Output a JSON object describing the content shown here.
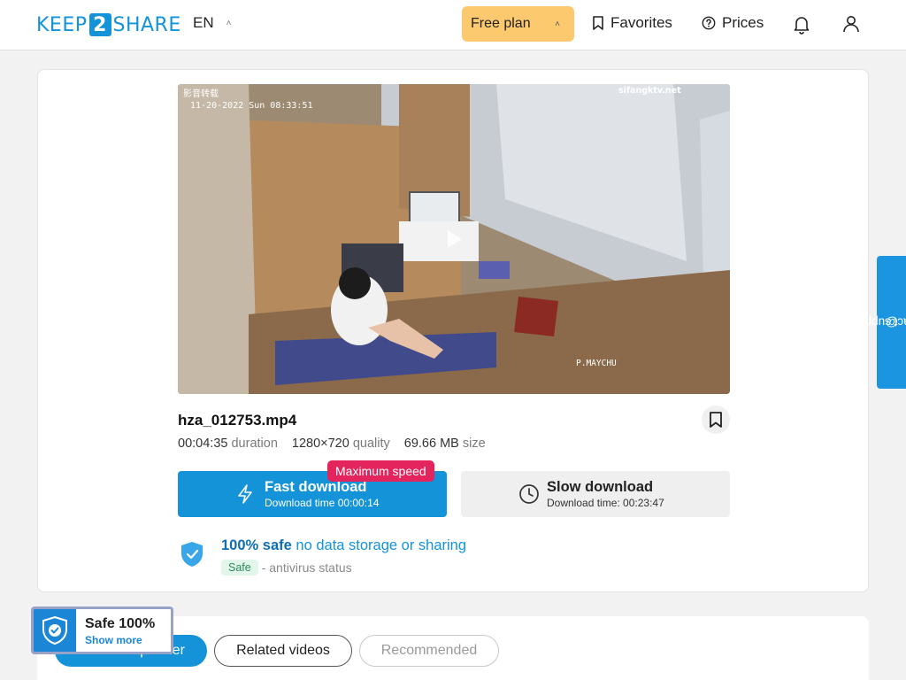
{
  "header": {
    "logo_left": "KEEP",
    "logo_number": "2",
    "logo_right": "SHARE",
    "language": "EN",
    "plan_label": "Free plan",
    "favorites_label": "Favorites",
    "prices_label": "Prices",
    "icons": [
      "bookmark-icon",
      "help-circle-icon",
      "bell-icon",
      "user-icon"
    ],
    "plan_color": "#fcc96f"
  },
  "video": {
    "overlay_timestamp": "11-20-2022 Sun 08:33:51",
    "overlay_site": "sifangktv.net",
    "overlay_corner": "影音转载",
    "overlay_room": "P.MAYCHU"
  },
  "file": {
    "name": "hza_012753.mp4",
    "duration_value": "00:04:35",
    "duration_label": "duration",
    "quality_value": "1280×720",
    "quality_label": "quality",
    "size_value": "69.66 MB",
    "size_label": "size"
  },
  "download": {
    "fast_title": "Fast download",
    "fast_subtitle": "Download time 00:00:14",
    "max_speed_badge": "Maximum speed",
    "slow_title": "Slow download",
    "slow_subtitle": "Download time: 00:23:47",
    "accent_color": "#1493d8",
    "badge_color": "#e4245d"
  },
  "safety": {
    "headline_bold": "100% safe",
    "headline_rest": "no data storage or sharing",
    "status_badge": "Safe",
    "status_text": "- antivirus status"
  },
  "tabs": [
    {
      "label": "From this partner",
      "active": true
    },
    {
      "label": "Related videos",
      "active": false
    },
    {
      "label": "Recommended",
      "active": false
    }
  ],
  "safe_widget": {
    "title": "Safe 100%",
    "link": "Show more"
  },
  "support": {
    "label": "contact support"
  }
}
